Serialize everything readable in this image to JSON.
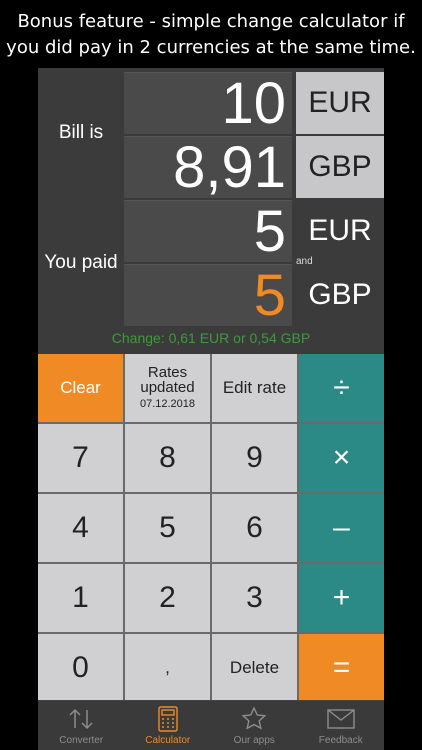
{
  "promo_text": "Bonus feature - simple change calculator if you did pay in 2 currencies at the same time.",
  "display": {
    "bill_label": "Bill is",
    "paid_label": "You paid",
    "bill_eur_value": "10",
    "bill_eur_currency": "EUR",
    "bill_gbp_value": "8,91",
    "bill_gbp_currency": "GBP",
    "paid_eur_value": "5",
    "paid_eur_currency": "EUR",
    "and_label": "and",
    "paid_gbp_value": "5",
    "paid_gbp_currency": "GBP",
    "change_text": "Change: 0,61 EUR or 0,54 GBP"
  },
  "keys": {
    "clear": "Clear",
    "rates_title": "Rates updated",
    "rates_date": "07.12.2018",
    "edit_rate": "Edit rate",
    "divide": "÷",
    "k7": "7",
    "k8": "8",
    "k9": "9",
    "multiply": "×",
    "k4": "4",
    "k5": "5",
    "k6": "6",
    "minus": "–",
    "k1": "1",
    "k2": "2",
    "k3": "3",
    "plus": "+",
    "k0": "0",
    "comma": ",",
    "delete": "Delete",
    "equals": "="
  },
  "tabs": [
    {
      "label": "Converter",
      "icon": "arrows-updown-icon"
    },
    {
      "label": "Calculator",
      "icon": "calculator-icon"
    },
    {
      "label": "Our apps",
      "icon": "star-icon"
    },
    {
      "label": "Feedback",
      "icon": "envelope-icon"
    }
  ],
  "colors": {
    "accent_orange": "#f08a24",
    "teal": "#2c8a86",
    "change_green": "#3d9a3a"
  }
}
